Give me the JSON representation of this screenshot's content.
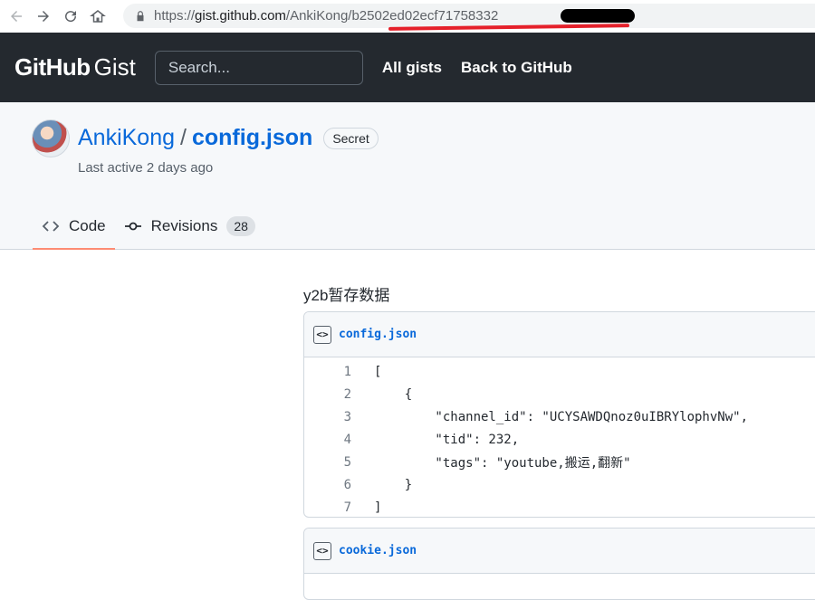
{
  "browser": {
    "url_prefix": "https://",
    "url_domain": "gist.github.com",
    "url_path": "/AnkiKong/",
    "url_hash": "b2502ed02ecf71758332"
  },
  "header": {
    "logo_github": "GitHub",
    "logo_gist": "Gist",
    "search_placeholder": "Search...",
    "links": [
      "All gists",
      "Back to GitHub"
    ]
  },
  "gist": {
    "owner": "AnkiKong",
    "separator": "/",
    "filename": "config.json",
    "badge": "Secret",
    "last_active": "Last active 2 days ago",
    "description": "y2b暂存数据"
  },
  "tabs": [
    {
      "label": "Code",
      "active": true
    },
    {
      "label": "Revisions",
      "count": "28",
      "active": false
    }
  ],
  "files": [
    {
      "name": "config.json",
      "lines": [
        {
          "n": "1",
          "text": "["
        },
        {
          "n": "2",
          "text": "    {"
        },
        {
          "n": "3",
          "text": "        \"channel_id\": \"UCYSAWDQnoz0uIBRYlophvNw\","
        },
        {
          "n": "4",
          "text": "        \"tid\": 232,"
        },
        {
          "n": "5",
          "text": "        \"tags\": \"youtube,搬运,翻新\""
        },
        {
          "n": "6",
          "text": "    }"
        },
        {
          "n": "7",
          "text": "]"
        }
      ]
    },
    {
      "name": "cookie.json",
      "lines": []
    }
  ],
  "colors": {
    "header_bg": "#24292f",
    "link_blue": "#0969da",
    "tab_underline": "#fd8c73",
    "annotation_red": "#e5202a"
  }
}
